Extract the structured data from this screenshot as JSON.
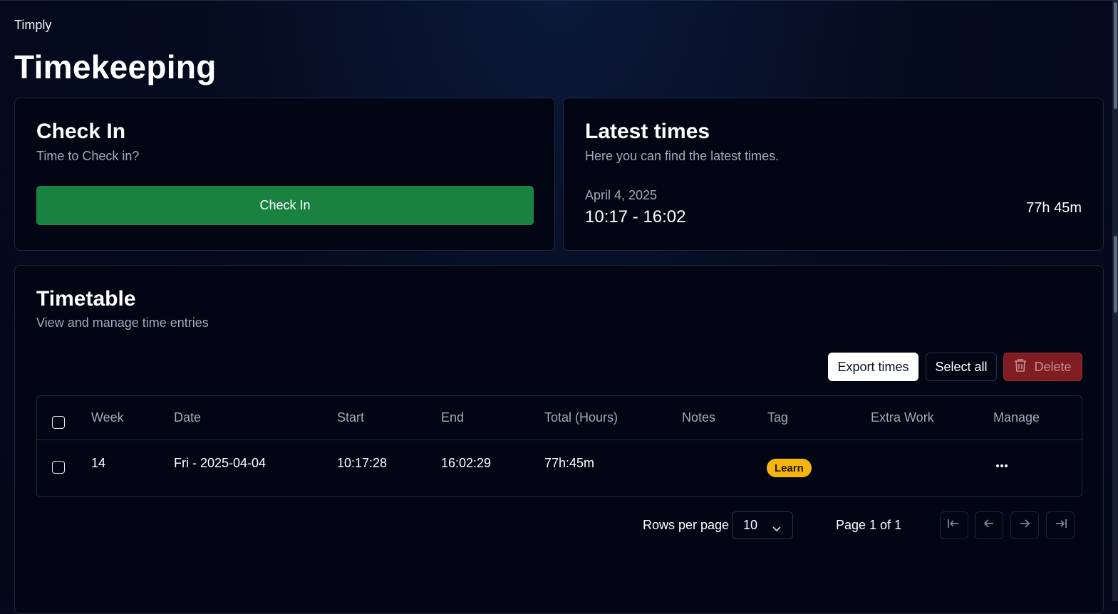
{
  "app": {
    "brand": "Timply",
    "page_title": "Timekeeping"
  },
  "checkin": {
    "title": "Check In",
    "subtitle": "Time to Check in?",
    "button_label": "Check In"
  },
  "latest": {
    "title": "Latest times",
    "subtitle": "Here you can find the latest times.",
    "date": "April 4, 2025",
    "range": "10:17 - 16:02",
    "total": "77h 45m"
  },
  "timetable": {
    "title": "Timetable",
    "subtitle": "View and manage time entries",
    "toolbar": {
      "export_label": "Export times",
      "select_all_label": "Select all",
      "delete_label": "Delete"
    },
    "columns": [
      "Week",
      "Date",
      "Start",
      "End",
      "Total (Hours)",
      "Notes",
      "Tag",
      "Extra Work",
      "Manage"
    ],
    "rows": [
      {
        "week": "14",
        "date": "Fri - 2025-04-04",
        "start": "10:17:28",
        "end": "16:02:29",
        "total": "77h:45m",
        "notes": "",
        "tag": "Learn",
        "extra_work": ""
      }
    ],
    "pagination": {
      "rows_per_page_label": "Rows per page",
      "rows_per_page_value": "10",
      "page_label": "Page 1 of 1"
    }
  },
  "colors": {
    "check_in_green": "#1a8240",
    "delete_red": "#7f1d22",
    "tag_yellow": "#f5b50b"
  },
  "icons": [
    "trash-icon",
    "more-horizontal-icon",
    "chevron-down-icon",
    "first-page-icon",
    "prev-page-icon",
    "next-page-icon",
    "last-page-icon"
  ]
}
